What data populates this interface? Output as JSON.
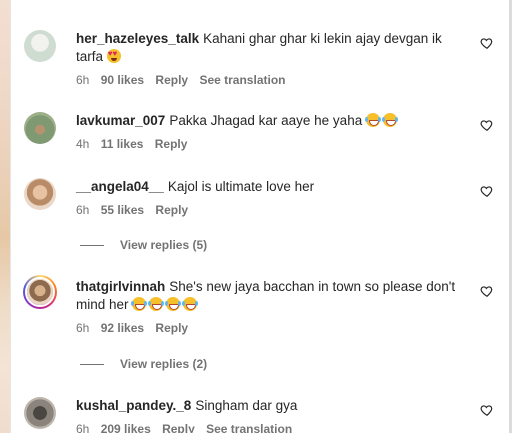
{
  "comments": [
    {
      "username": "her_hazeleyes_talk",
      "text": "Kahani ghar ghar ki lekin ajay devgan ik tarfa",
      "emojis": [
        "heart-eyes"
      ],
      "time": "6h",
      "likes": "90 likes",
      "reply": "Reply",
      "translate": "See translation",
      "avatar_color": "#d9e6dd"
    },
    {
      "username": "lavkumar_007",
      "text": "Pakka Jhagad kar aaye he yaha",
      "emojis": [
        "laugh",
        "laugh"
      ],
      "time": "4h",
      "likes": "11 likes",
      "reply": "Reply",
      "avatar_color": "#8fa67e"
    },
    {
      "username": "__angela04__",
      "text": "Kajol is ultimate love her",
      "emojis": [],
      "time": "6h",
      "likes": "55 likes",
      "reply": "Reply",
      "view_replies": "View replies (5)",
      "avatar_color": "#d8b08f"
    },
    {
      "username": "thatgirlvinnah",
      "text": "She's new jaya bacchan in town so please don't mind her",
      "emojis": [
        "laugh",
        "laugh",
        "laugh",
        "laugh"
      ],
      "time": "6h",
      "likes": "92 likes",
      "reply": "Reply",
      "view_replies": "View replies (2)",
      "avatar_color": "#c79a73"
    },
    {
      "username": "kushal_pandey._8",
      "text": "Singham dar gya",
      "emojis": [],
      "time": "6h",
      "likes": "209 likes",
      "reply": "Reply",
      "translate": "See translation",
      "avatar_color": "#6f6a63"
    }
  ],
  "colors": {
    "text": "#262626",
    "meta": "#737373",
    "heart_stroke": "#262626"
  }
}
